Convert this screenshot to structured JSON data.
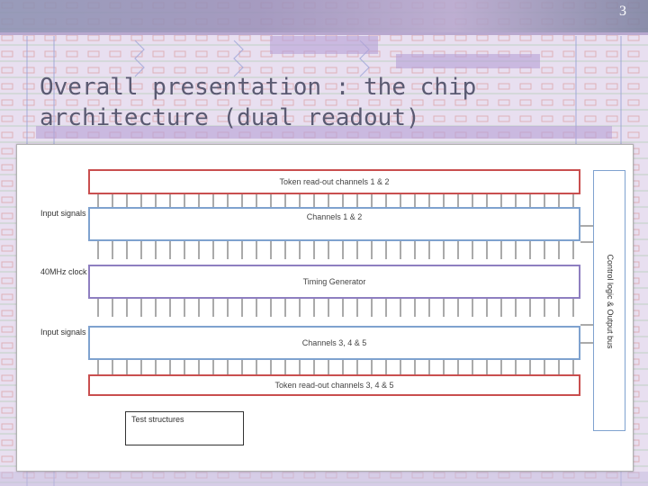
{
  "page_number": "3",
  "title": "Overall presentation : the chip architecture (dual readout)",
  "diagram": {
    "blocks": {
      "token_top": "Token read-out channels 1 & 2",
      "channels_12": "Channels 1 & 2",
      "timing": "Timing Generator",
      "channels_345": "Channels 3, 4 & 5",
      "token_bottom": "Token read-out channels 3, 4 & 5",
      "control": "Control logic & Output bus",
      "test": "Test structures"
    },
    "side_labels": {
      "input_top": "Input signals",
      "clock": "40MHz clock",
      "input_bottom": "Input signals"
    },
    "colors": {
      "token_border": "#c94f4f",
      "channel_border": "#7fa2cf",
      "timing_border": "#8e7fc0"
    }
  }
}
